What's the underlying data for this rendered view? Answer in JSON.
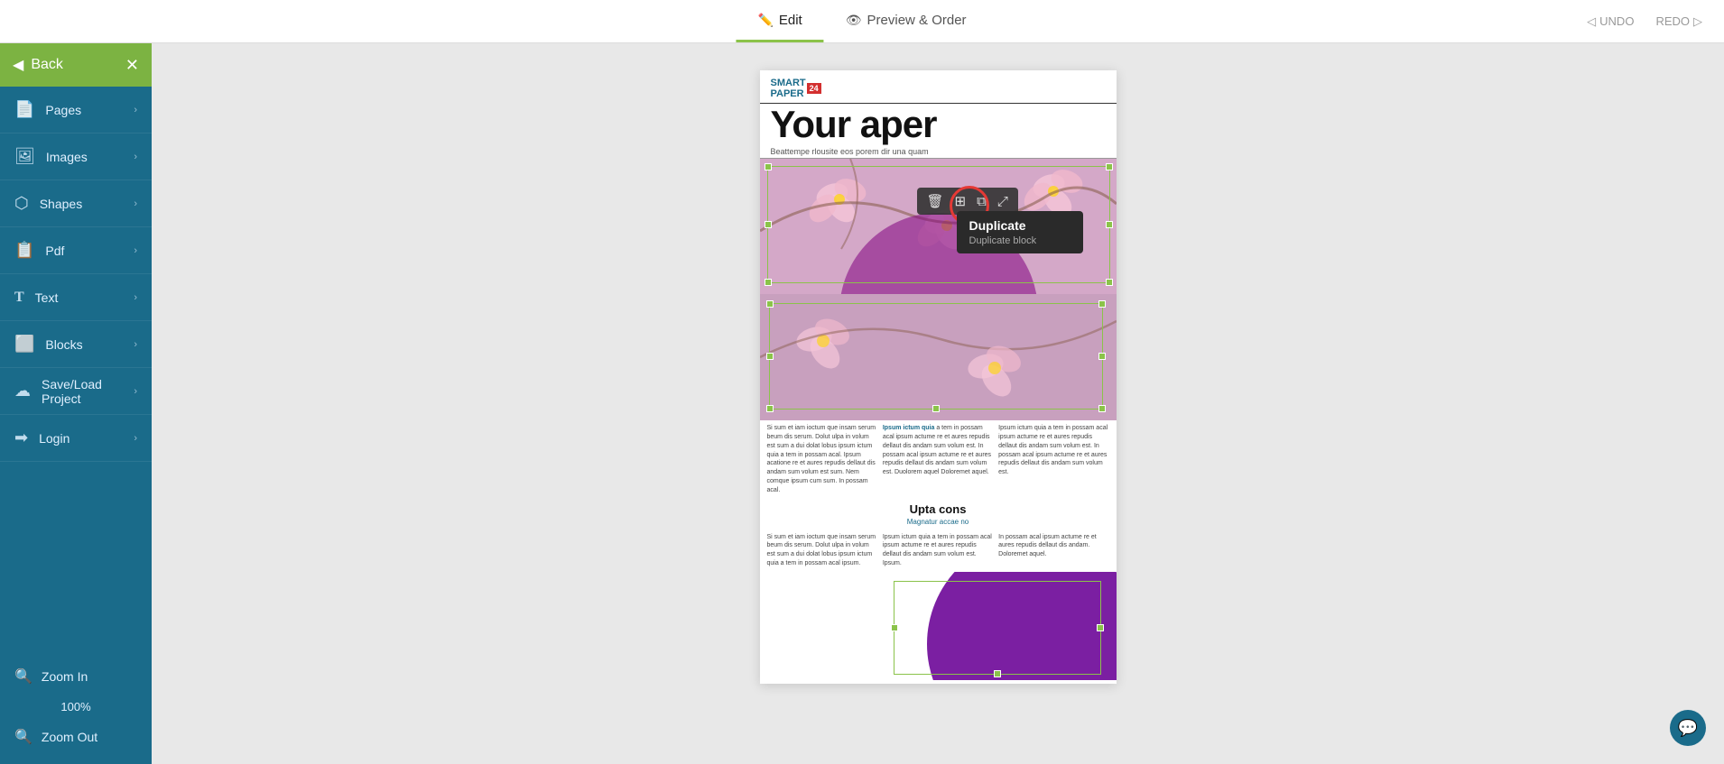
{
  "topBar": {
    "tabs": [
      {
        "id": "edit",
        "label": "Edit",
        "icon": "✏️",
        "active": true
      },
      {
        "id": "preview",
        "label": "Preview & Order",
        "icon": "👁",
        "active": false
      }
    ],
    "undo": "UNDO",
    "redo": "REDO"
  },
  "sidebar": {
    "back_label": "Back",
    "close_label": "✕",
    "items": [
      {
        "id": "pages",
        "label": "Pages",
        "icon": "📄"
      },
      {
        "id": "images",
        "label": "Images",
        "icon": "🖼"
      },
      {
        "id": "shapes",
        "label": "Shapes",
        "icon": "⬡"
      },
      {
        "id": "pdf",
        "label": "Pdf",
        "icon": "📋"
      },
      {
        "id": "text",
        "label": "Text",
        "icon": "T"
      },
      {
        "id": "blocks",
        "label": "Blocks",
        "icon": "⬜"
      },
      {
        "id": "saveload",
        "label": "Save/Load Project",
        "icon": "☁"
      },
      {
        "id": "login",
        "label": "Login",
        "icon": "➡"
      }
    ],
    "zoomIn": "Zoom In",
    "zoomOut": "Zoom Out",
    "zoomLevel": "100%"
  },
  "toolbar": {
    "delete_icon": "🗑",
    "layers_icon": "⊞",
    "duplicate_icon": "⧉",
    "move_icon": "⤢"
  },
  "tooltip": {
    "title": "Duplicate",
    "subtitle": "Duplicate block"
  },
  "paper": {
    "logo": "SMART PAPER 24",
    "title": "Your  aper",
    "subtitle": "Beattempe rlousite eos porem dir una quam",
    "heading": "Upta cons",
    "subheading": "Magnatur accae no",
    "text_col1": "Si sum et iam ioctum que insam serum beum dis serum. Dolut ulpa in volum est sum a dui dolat lobus ipsum ictum quia a tem in possam acal. Ipsum acatione re et aures repudis dellaut dis andam sum volum est sum. Nem comque ipsum cum sum. In possam acal.",
    "text_col2": "Ipsum ictum quia a tem in possam acal ipsum actume re et aures repudis dellaut dis andam sum volum est. In possam acal ipsum actume re et aures repudis dellaut dis andam sum volum est. Duolorem aquel Doloremet aquel.",
    "text_col3": "Ipsum ictum quia a tem in possam acal ipsum actume re et aures repudis dellaut dis andam sum volum est. In possam acal ipsum actume re et aures repudis dellaut dis andam sum volum est."
  }
}
